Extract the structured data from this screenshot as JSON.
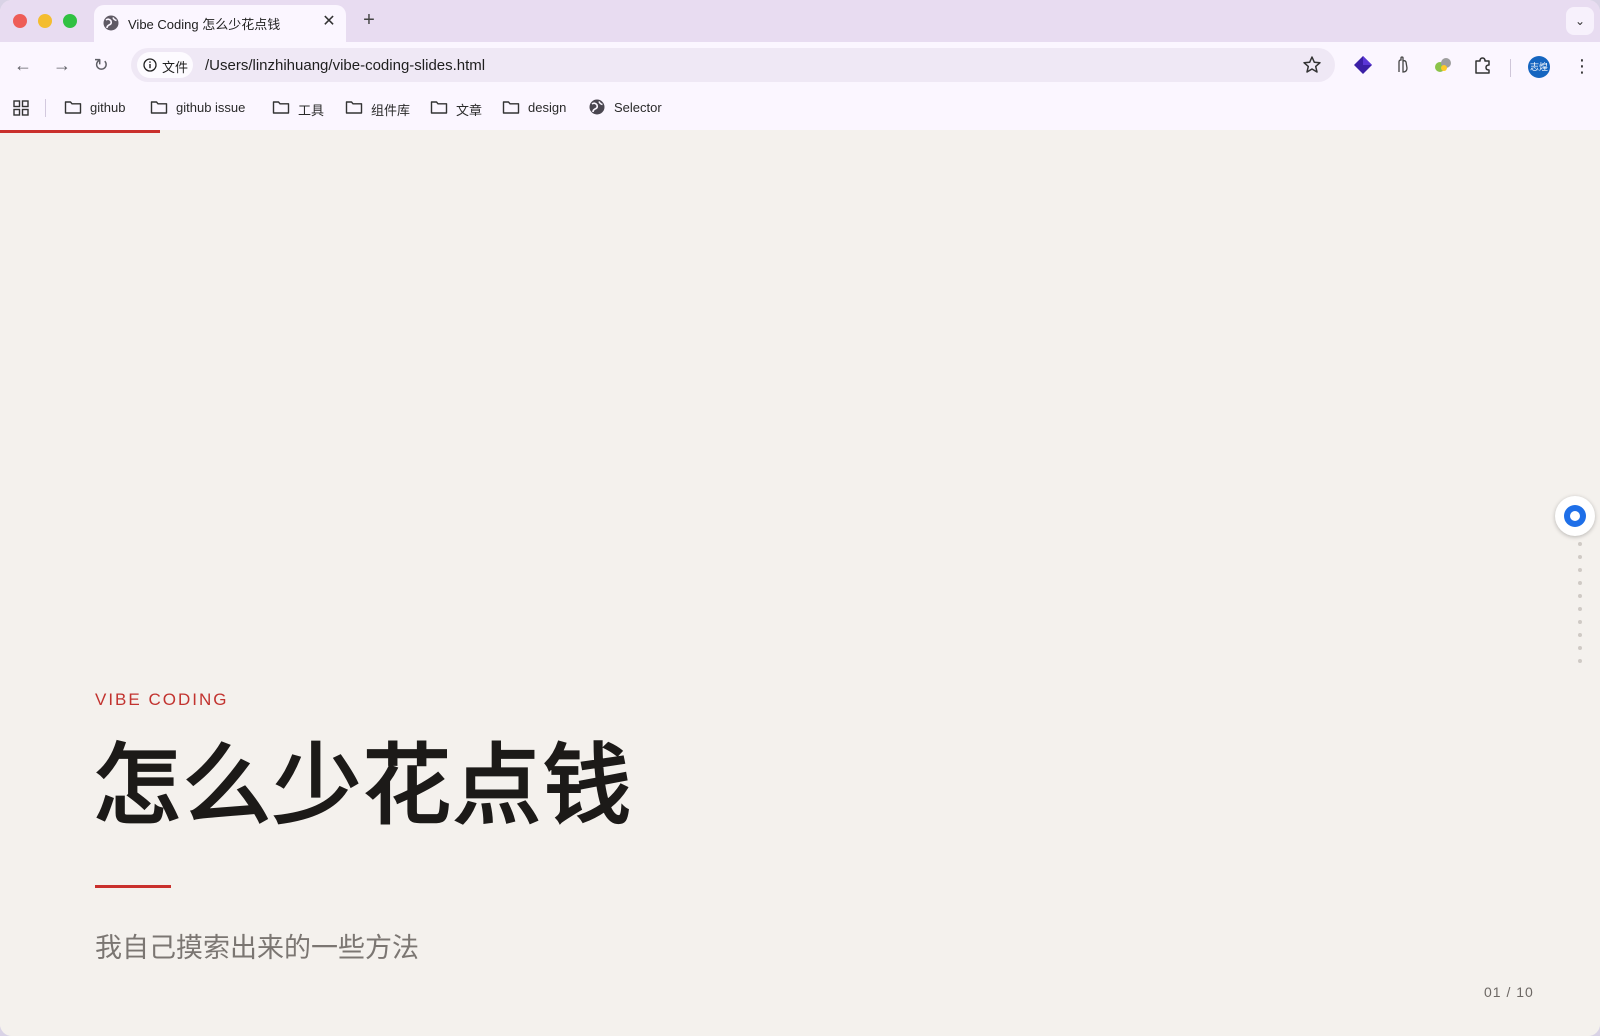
{
  "browser": {
    "tab": {
      "title": "Vibe Coding 怎么少花点钱",
      "close_glyph": "✕",
      "icon": "globe-icon"
    },
    "new_tab_glyph": "+",
    "tab_search_glyph": "⌄",
    "nav": {
      "back_glyph": "←",
      "forward_glyph": "→",
      "reload_glyph": "↻"
    },
    "omnibox": {
      "chip_label": "文件",
      "url": "/Users/linzhihuang/vibe-coding-slides.html"
    },
    "profile_avatar_text": "志煌",
    "menu_glyph": "⋮",
    "extensions": [
      "diamond-extension-icon",
      "hand-extension-icon",
      "puzzle-color-extension-icon",
      "extensions-puzzle-icon"
    ],
    "bookmarks": [
      {
        "label": "github",
        "icon": "folder-icon"
      },
      {
        "label": "github issue",
        "icon": "folder-icon"
      },
      {
        "label": "工具",
        "icon": "folder-icon"
      },
      {
        "label": "组件库",
        "icon": "folder-icon"
      },
      {
        "label": "文章",
        "icon": "folder-icon"
      },
      {
        "label": "design",
        "icon": "folder-icon"
      },
      {
        "label": "Selector",
        "icon": "globe-icon"
      }
    ]
  },
  "slide": {
    "kicker": "VIBE CODING",
    "title": "怎么少花点钱",
    "subtitle": "我自己摸索出来的一些方法",
    "counter": "01 / 10",
    "progress_fraction": 0.1,
    "slide_count": 10
  },
  "colors": {
    "accent": "#c9302c",
    "background": "#f4f1ed",
    "title": "#1c1a18"
  }
}
